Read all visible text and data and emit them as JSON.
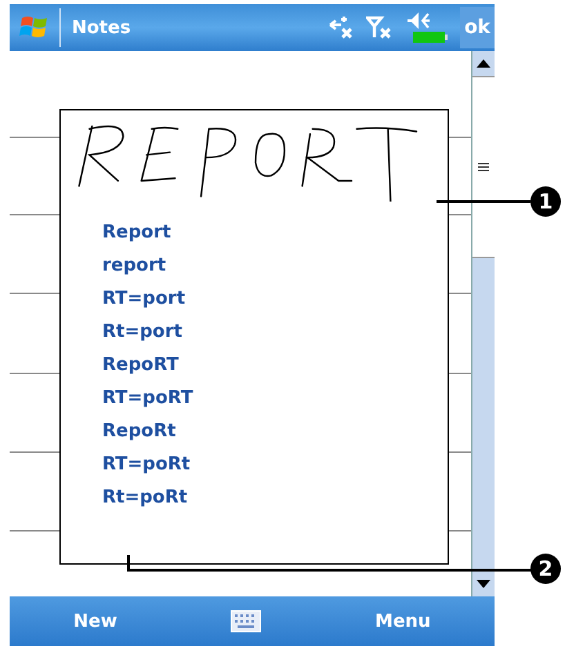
{
  "title_bar": {
    "title": "Notes",
    "ok": "ok"
  },
  "suggestions": [
    {
      "text": "Report"
    },
    {
      "text": "report"
    },
    {
      "text": "RT=port"
    },
    {
      "text": "Rt=port"
    },
    {
      "text": "RepoRT"
    },
    {
      "text": "RT=poRT"
    },
    {
      "text": "RepoRt"
    },
    {
      "text": "RT=poRt"
    },
    {
      "text": "Rt=poRt"
    }
  ],
  "callouts": [
    "1",
    "2"
  ],
  "menu_bar": {
    "left": "New",
    "right": "Menu"
  }
}
